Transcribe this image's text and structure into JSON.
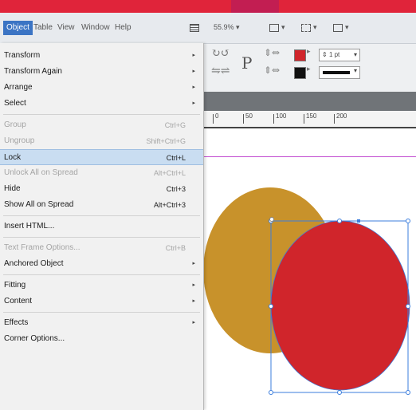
{
  "menubar": {
    "items": [
      {
        "label": "Object",
        "active": true
      },
      {
        "label": "Table"
      },
      {
        "label": "View"
      },
      {
        "label": "Window"
      },
      {
        "label": "Help"
      }
    ],
    "zoom": "55.9%"
  },
  "control_panel": {
    "reference_char": "P",
    "stroke_weight": "1 pt"
  },
  "menu": {
    "items": [
      {
        "label": "Transform",
        "shortcut": "",
        "submenu": true,
        "disabled": false
      },
      {
        "label": "Transform Again",
        "shortcut": "",
        "submenu": true,
        "disabled": false
      },
      {
        "label": "Arrange",
        "shortcut": "",
        "submenu": true,
        "disabled": false
      },
      {
        "label": "Select",
        "shortcut": "",
        "submenu": true,
        "disabled": false
      },
      {
        "separator": true
      },
      {
        "label": "Group",
        "shortcut": "Ctrl+G",
        "disabled": true
      },
      {
        "label": "Ungroup",
        "shortcut": "Shift+Ctrl+G",
        "disabled": true
      },
      {
        "label": "Lock",
        "shortcut": "Ctrl+L",
        "disabled": false,
        "highlighted": true
      },
      {
        "label": "Unlock All on Spread",
        "shortcut": "Alt+Ctrl+L",
        "disabled": true
      },
      {
        "label": "Hide",
        "shortcut": "Ctrl+3",
        "disabled": false
      },
      {
        "label": "Show All on Spread",
        "shortcut": "Alt+Ctrl+3",
        "disabled": false
      },
      {
        "separator": true
      },
      {
        "label": "Insert HTML...",
        "shortcut": "",
        "disabled": false
      },
      {
        "separator": true
      },
      {
        "label": "Text Frame Options...",
        "shortcut": "Ctrl+B",
        "disabled": true
      },
      {
        "label": "Anchored Object",
        "shortcut": "",
        "submenu": true,
        "disabled": false
      },
      {
        "separator": true
      },
      {
        "label": "Fitting",
        "shortcut": "",
        "submenu": true,
        "disabled": false
      },
      {
        "label": "Content",
        "shortcut": "",
        "submenu": true,
        "disabled": false
      },
      {
        "separator": true
      },
      {
        "label": "Effects",
        "shortcut": "",
        "submenu": true,
        "disabled": false
      },
      {
        "label": "Corner Options...",
        "shortcut": "",
        "disabled": false
      }
    ]
  },
  "ruler": {
    "labels": [
      "0",
      "50",
      "100",
      "150",
      "200"
    ]
  },
  "canvas": {
    "shapes": [
      {
        "name": "gold-ellipse",
        "color": "#c8922b"
      },
      {
        "name": "red-ellipse",
        "color": "#d0252b",
        "selected": true
      }
    ],
    "selection_color": "#3b7ddd"
  },
  "colors": {
    "accent": "#e0243a",
    "menu_highlight": "#c9ddf1"
  }
}
